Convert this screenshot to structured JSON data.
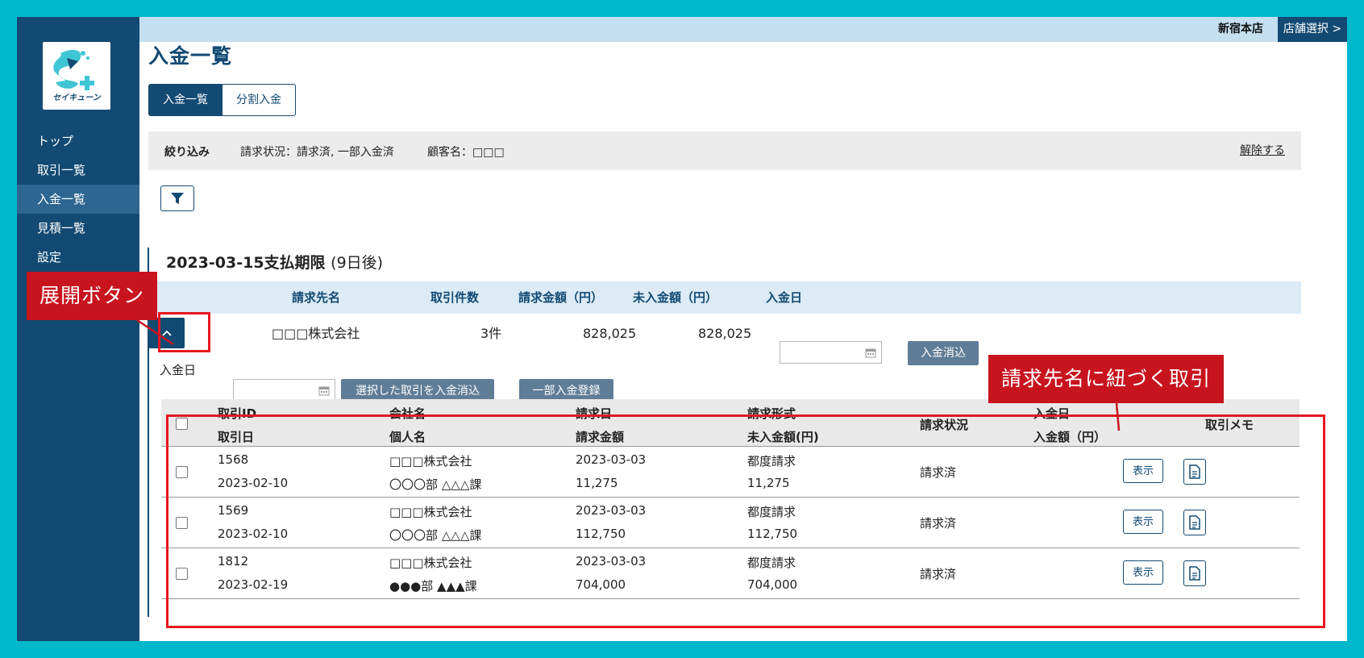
{
  "sidebar": {
    "logo_text": "セイキューン",
    "items": [
      {
        "label": "トップ"
      },
      {
        "label": "取引一覧"
      },
      {
        "label": "入金一覧"
      },
      {
        "label": "見積一覧"
      },
      {
        "label": "設定"
      }
    ]
  },
  "topbar": {
    "store_name": "新宿本店",
    "store_select": "店舗選択 >"
  },
  "page": {
    "title": "入金一覧",
    "tabs": [
      {
        "label": "入金一覧"
      },
      {
        "label": "分割入金"
      }
    ]
  },
  "filter": {
    "label": "絞り込み",
    "conditions": [
      "請求状況：請求済, 一部入金済",
      "顧客名：□□□"
    ],
    "clear": "解除する"
  },
  "group": {
    "title": "2023-03-15支払期限",
    "title_sub": "(9日後)",
    "columns": [
      "請求先名",
      "取引件数",
      "請求金額（円）",
      "未入金額（円）",
      "入金日"
    ],
    "summary": {
      "customer": "□□□株式会社",
      "count": "3件",
      "amount": "828,025",
      "unpaid": "828,025"
    },
    "clear_button": "入金消込"
  },
  "bulk": {
    "date_label": "入金日",
    "clear_selected": "選択した取引を入金消込",
    "partial_register": "一部入金登録"
  },
  "table": {
    "headers": {
      "id": "取引ID",
      "date": "取引日",
      "company": "会社名",
      "person": "個人名",
      "bill_date": "請求日",
      "bill_amount": "請求金額",
      "bill_type": "請求形式",
      "unpaid": "未入金額(円)",
      "status": "請求状況",
      "pay_date": "入金日",
      "pay_amount": "入金額（円）",
      "memo": "取引メモ"
    },
    "rows": [
      {
        "id": "1568",
        "date": "2023-02-10",
        "company": "□□□株式会社",
        "person": "〇〇〇部 △△△課",
        "bill_date": "2023-03-03",
        "bill_amount": "11,275",
        "bill_type": "都度請求",
        "unpaid": "11,275",
        "status": "請求済",
        "show": "表示"
      },
      {
        "id": "1569",
        "date": "2023-02-10",
        "company": "□□□株式会社",
        "person": "〇〇〇部 △△△課",
        "bill_date": "2023-03-03",
        "bill_amount": "112,750",
        "bill_type": "都度請求",
        "unpaid": "112,750",
        "status": "請求済",
        "show": "表示"
      },
      {
        "id": "1812",
        "date": "2023-02-19",
        "company": "□□□株式会社",
        "person": "●●●部 ▲▲▲課",
        "bill_date": "2023-03-03",
        "bill_amount": "704,000",
        "bill_type": "都度請求",
        "unpaid": "704,000",
        "status": "請求済",
        "show": "表示"
      }
    ]
  },
  "annotations": {
    "expand": "展開ボタン",
    "linked": "請求先名に紐づく取引"
  },
  "colors": {
    "frame": "#00b8cc",
    "navy": "#124a73",
    "accent_red": "#c8141e"
  }
}
